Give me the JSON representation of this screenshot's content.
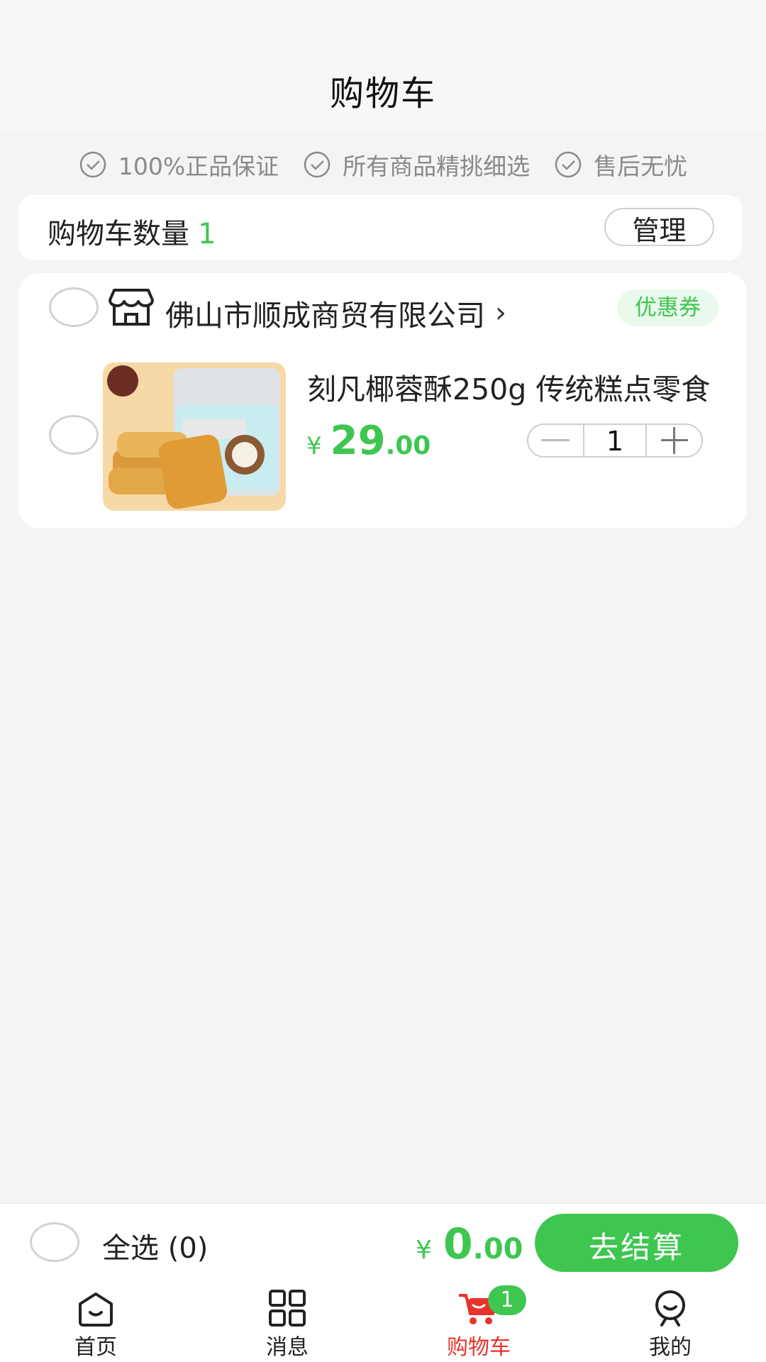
{
  "header": {
    "title": "购物车"
  },
  "guarantees": [
    {
      "label": "100%正品保证"
    },
    {
      "label": "所有商品精挑细选"
    },
    {
      "label": "售后无忧"
    }
  ],
  "cart_count": {
    "label": "购物车数量",
    "value": "1",
    "manage_label": "管理"
  },
  "shop": {
    "name": "佛山市顺成商贸有限公司",
    "coupon_label": "优惠券",
    "items": [
      {
        "title": "刻凡椰蓉酥250g 传统糕点零食",
        "currency": "¥",
        "price_int": "29",
        "price_dec": ".00",
        "quantity": "1"
      }
    ]
  },
  "checkout": {
    "select_all_label": "全选 (0)",
    "currency": "¥",
    "total_int": "0",
    "total_dec": ".00",
    "button_label": "去结算"
  },
  "tabbar": {
    "tabs": [
      {
        "label": "首页",
        "icon": "home-icon"
      },
      {
        "label": "消息",
        "icon": "grid-icon"
      },
      {
        "label": "购物车",
        "icon": "cart-icon",
        "badge": "1",
        "active": true
      },
      {
        "label": "我的",
        "icon": "profile-icon"
      }
    ]
  },
  "colors": {
    "accent": "#3fc651",
    "active_tab": "#e8332c"
  }
}
